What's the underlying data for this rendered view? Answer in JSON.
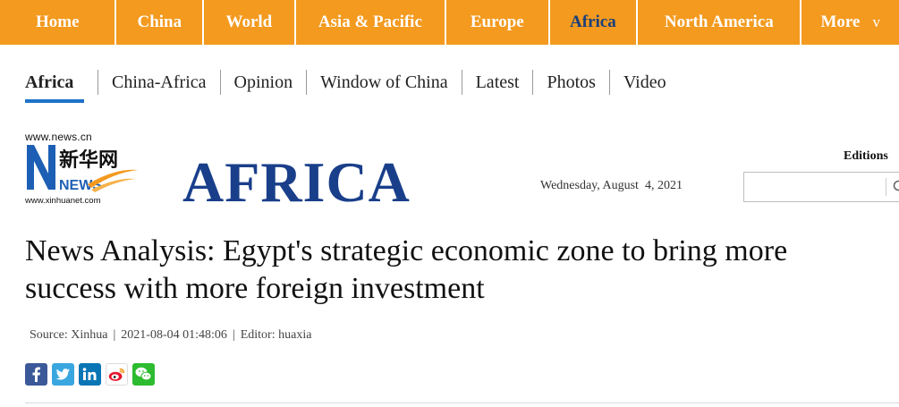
{
  "top_nav": {
    "items": [
      {
        "label": "Home"
      },
      {
        "label": "China"
      },
      {
        "label": "World"
      },
      {
        "label": "Asia & Pacific"
      },
      {
        "label": "Europe"
      },
      {
        "label": "Africa",
        "active": true
      },
      {
        "label": "North America"
      },
      {
        "label": "More"
      }
    ],
    "more_arrow": "v",
    "bar_color": "#f39a1f",
    "active_color": "#1a3f7a"
  },
  "sub_nav": {
    "items": [
      {
        "label": "Africa",
        "active": true
      },
      {
        "label": "China-Africa"
      },
      {
        "label": "Opinion"
      },
      {
        "label": "Window of China"
      },
      {
        "label": "Latest"
      },
      {
        "label": "Photos"
      },
      {
        "label": "Video"
      }
    ],
    "accent_color": "#1e73c8"
  },
  "logo": {
    "url_top": "www.news.cn",
    "chinese": "新华网",
    "news_text": "NEWS",
    "url_bottom": "www.xinhuanet.com"
  },
  "section_title": "AFRICA",
  "date": "Wednesday, August  4, 2021",
  "editions_label": "Editions",
  "search": {
    "value": "",
    "icon": "search-icon"
  },
  "article": {
    "headline": "News Analysis: Egypt's strategic economic zone to bring more success with more foreign investment",
    "source": "Source: Xinhua",
    "timestamp": "2021-08-04 01:48:06",
    "editor": "Editor: huaxia",
    "separator": "|"
  },
  "share_icons": [
    "facebook-icon",
    "twitter-icon",
    "linkedin-icon",
    "weibo-icon",
    "wechat-icon"
  ]
}
